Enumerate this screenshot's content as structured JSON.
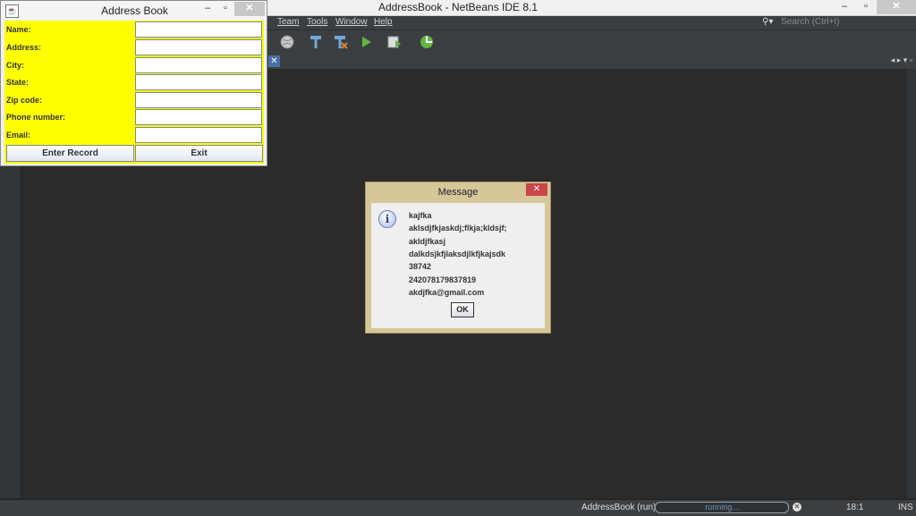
{
  "ide": {
    "title": "AddressBook - NetBeans IDE 8.1",
    "menu": [
      "Team",
      "Tools",
      "Window",
      "Help"
    ],
    "search_placeholder": "Search (Ctrl+I)",
    "window_controls": {
      "minimize": "–",
      "maximize": "▫",
      "close": "✕"
    }
  },
  "address_book": {
    "title": "Address Book",
    "fields": [
      {
        "label": "Name:",
        "value": ""
      },
      {
        "label": "Address:",
        "value": ""
      },
      {
        "label": "City:",
        "value": ""
      },
      {
        "label": "State:",
        "value": ""
      },
      {
        "label": "Zip code:",
        "value": ""
      },
      {
        "label": "Phone number:",
        "value": ""
      },
      {
        "label": "Email:",
        "value": ""
      }
    ],
    "enter_button": "Enter Record",
    "exit_button": "Exit",
    "background_color": "#ffff00"
  },
  "message_dialog": {
    "title": "Message",
    "lines": [
      "kajfka",
      "aklsdjfkjaskdj;flkja;kldsjf;",
      "akldjfkasj",
      "dalkdsjkfjlaksdjlkfjkajsdk",
      "38742",
      "242078179837819",
      "akdjfka@gmail.com"
    ],
    "ok_button": "OK",
    "icon": "info-icon"
  },
  "status": {
    "task": "AddressBook (run)",
    "progress_text": "running...",
    "position": "18:1",
    "mode": "INS"
  }
}
